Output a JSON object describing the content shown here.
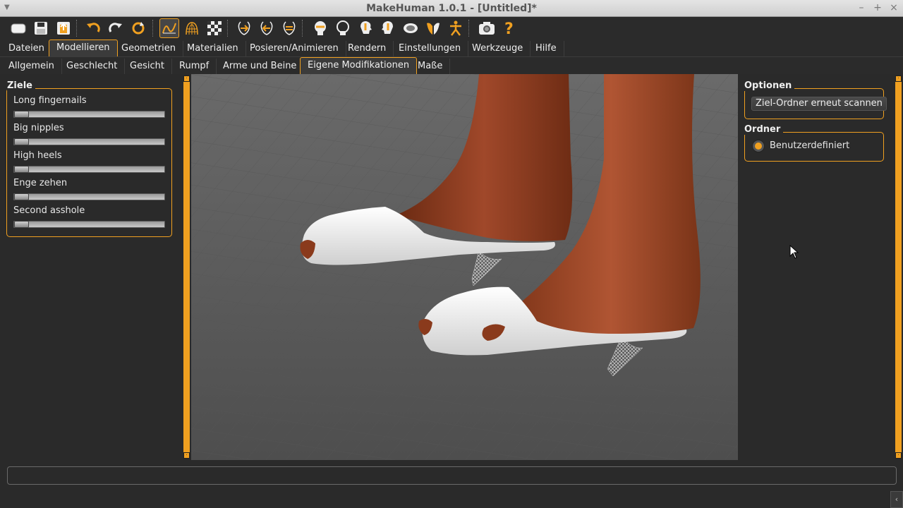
{
  "window": {
    "title": "MakeHuman 1.0.1 - [Untitled]*"
  },
  "colors": {
    "accent": "#f0a020",
    "background": "#2a2a2a",
    "skin": "#8a3a1c",
    "shoe": "#f2f2f2"
  },
  "toolbar": {
    "icons": [
      "open-file-icon",
      "save-icon",
      "export-icon",
      "undo-icon",
      "redo-icon",
      "reset-icon",
      "smooth-icon",
      "wireframe-icon",
      "checker-background-icon",
      "front-view-icon",
      "back-view-icon",
      "left-view-icon",
      "right-view-icon",
      "top-view-icon",
      "bottom-view-icon",
      "reset-camera-icon",
      "global-camera-icon",
      "symmetry-icon",
      "skeleton-icon",
      "screenshot-icon",
      "help-icon"
    ]
  },
  "main_tabs": [
    "Dateien",
    "Modellieren",
    "Geometrien",
    "Materialien",
    "Posieren/Animieren",
    "Rendern",
    "Einstellungen",
    "Werkzeuge",
    "Hilfe"
  ],
  "sub_tabs": [
    "Allgemein",
    "Geschlecht",
    "Gesicht",
    "Rumpf",
    "Arme und Beine",
    "Eigene Modifikationen",
    "Maße"
  ],
  "left": {
    "group_title": "Ziele",
    "sliders": [
      {
        "label": "Long fingernails",
        "value": 0
      },
      {
        "label": "Big nipples",
        "value": 0
      },
      {
        "label": "High heels",
        "value": 0
      },
      {
        "label": "Enge zehen",
        "value": 0
      },
      {
        "label": "Second asshole",
        "value": 0
      }
    ]
  },
  "right": {
    "options_title": "Optionen",
    "rescan_button": "Ziel-Ordner erneut scannen",
    "folder_title": "Ordner",
    "folder_radio": "Benutzerdefiniert"
  },
  "status": {
    "text": ""
  }
}
